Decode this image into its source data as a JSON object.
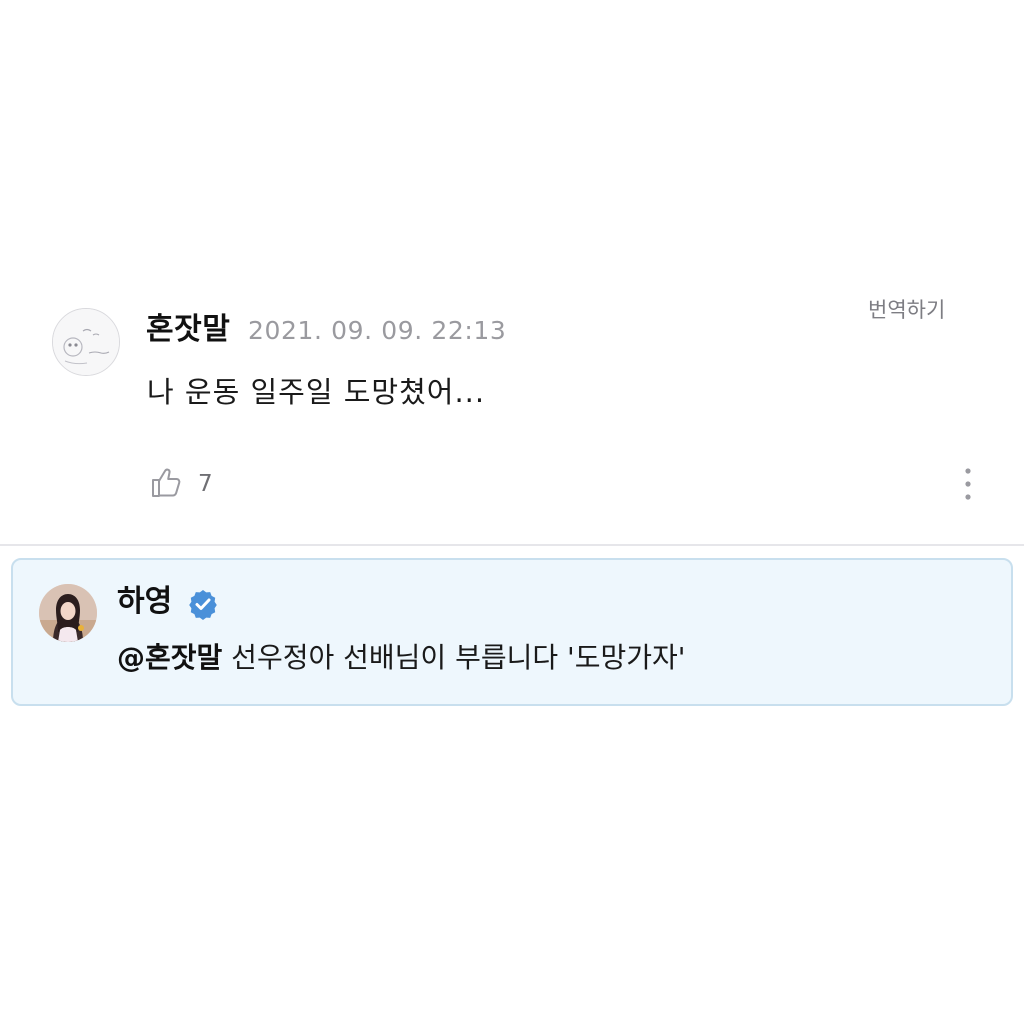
{
  "comment": {
    "username": "혼잣말",
    "timestamp": "2021. 09. 09. 22:13",
    "translate_label": "번역하기",
    "text": "나 운동 일주일 도망쳤어...",
    "like_count": "7",
    "icons": {
      "like": "thumbs-up-icon",
      "more": "more-vertical-icon"
    }
  },
  "reply": {
    "username": "하영",
    "mention": "@혼잣말",
    "text": " 선우정아 선배님이 부릅니다 '도망가자'",
    "verified_icon": "verified-badge-icon"
  },
  "colors": {
    "reply_background": "#eef7fd",
    "reply_border": "#c8dfee",
    "verified_badge": "#4a90d9",
    "secondary_text": "#9a9a9f"
  }
}
